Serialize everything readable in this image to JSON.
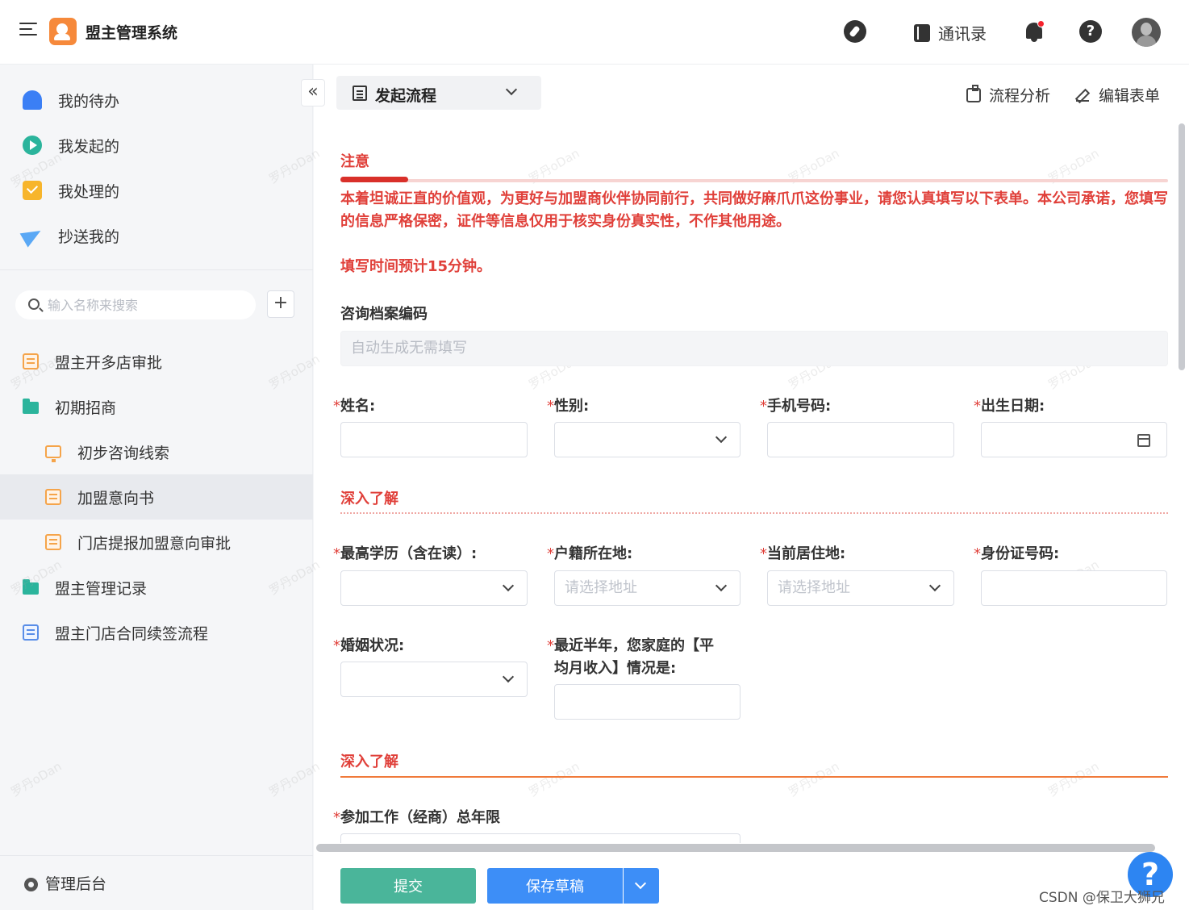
{
  "app": {
    "title": "盟主管理系统"
  },
  "header": {
    "contacts_label": "通讯录",
    "help_glyph": "?"
  },
  "sidebar": {
    "top_nav": [
      {
        "label": "我的待办",
        "icon": "bell-icon"
      },
      {
        "label": "我发起的",
        "icon": "play-icon"
      },
      {
        "label": "我处理的",
        "icon": "check-icon"
      },
      {
        "label": "抄送我的",
        "icon": "send-icon"
      }
    ],
    "search_placeholder": "输入名称来搜索",
    "add_glyph": "+",
    "tree": [
      {
        "label": "盟主开多店审批",
        "icon": "form-icon"
      },
      {
        "label": "初期招商",
        "icon": "folder-icon"
      },
      {
        "label": "初步咨询线索",
        "icon": "monitor-icon"
      },
      {
        "label": "加盟意向书",
        "icon": "form-icon",
        "active": true
      },
      {
        "label": "门店提报加盟意向审批",
        "icon": "form-icon"
      },
      {
        "label": "盟主管理记录",
        "icon": "folder-icon"
      },
      {
        "label": "盟主门店合同续签流程",
        "icon": "form-icon"
      }
    ],
    "admin_label": "管理后台"
  },
  "toolbar": {
    "collapse_glyph": "«",
    "flow_select": "发起流程",
    "flow_analysis": "流程分析",
    "edit_form": "编辑表单"
  },
  "form": {
    "notice_title": "注意",
    "notice_text": "本着坦诚正直的价值观，为更好与加盟商伙伴协同前行，共同做好麻爪爪这份事业，请您认真填写以下表单。本公司承诺，您填写的信息严格保密，证件等信息仅用于核实身份真实性，不作其他用途。",
    "notice_time": "填写时间预计15分钟。",
    "archive_code_label": "咨询档案编码",
    "archive_code_value": "自动生成无需填写",
    "required_mark": "*",
    "name_label": "姓名:",
    "gender_label": "性别:",
    "phone_label": "手机号码:",
    "birth_label": "出生日期:",
    "section1_title": "深入了解",
    "education_label": "最高学历（含在读）:",
    "hukou_label": "户籍所在地:",
    "hukou_placeholder": "请选择地址",
    "residence_label": "当前居住地:",
    "residence_placeholder": "请选择地址",
    "idcard_label": "身份证号码:",
    "marital_label": "婚姻状况:",
    "income_label_line1": "最近半年，您家庭的【平",
    "income_label_line2": "均月收入】情况是:",
    "section2_title": "深入了解",
    "work_years_label": "参加工作（经商）总年限"
  },
  "footer": {
    "submit_label": "提交",
    "save_draft_label": "保存草稿"
  },
  "float_help_glyph": "?",
  "watermark_text": "罗丹oDan",
  "csdn_mark": "CSDN @保卫大狮兄",
  "colors": {
    "accent_red": "#e0403a",
    "submit_green": "#4ab59a",
    "draft_blue": "#3d8ef7",
    "logo_orange": "#f6893b"
  }
}
